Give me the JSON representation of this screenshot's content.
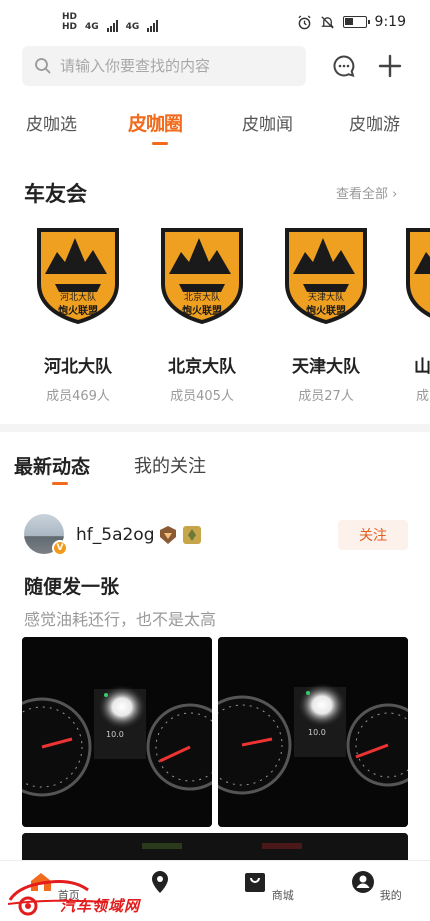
{
  "status": {
    "network1": "4G",
    "network2": "4G",
    "time": "9:19"
  },
  "search": {
    "placeholder": "请输入你要查找的内容"
  },
  "tabs": [
    "皮咖选",
    "皮咖圈",
    "皮咖闻",
    "皮咖游"
  ],
  "active_tab_index": 1,
  "clubs_section": {
    "title": "车友会",
    "see_all": "查看全部 ›",
    "badge_footer": "炮火联盟",
    "clubs": [
      {
        "badge_label": "河北大队",
        "name": "河北大队",
        "members": "成员469人"
      },
      {
        "badge_label": "北京大队",
        "name": "北京大队",
        "members": "成员405人"
      },
      {
        "badge_label": "天津大队",
        "name": "天津大队",
        "members": "成员27人"
      },
      {
        "badge_label": "山",
        "name": "山",
        "members": "成"
      }
    ]
  },
  "feed": {
    "tabs": [
      "最新动态",
      "我的关注"
    ],
    "post": {
      "username": "hf_5a2og",
      "follow_label": "关注",
      "title": "随便发一张",
      "description": "感觉油耗还行，也不是太高",
      "dash_reading": "10.0"
    }
  },
  "bottom_nav": [
    {
      "label": "首页",
      "icon": "home-icon"
    },
    {
      "label": "",
      "icon": "location-pin-icon"
    },
    {
      "label": "商城",
      "icon": "shop-bag-icon"
    },
    {
      "label": "我的",
      "icon": "profile-icon"
    }
  ],
  "watermark": {
    "text": "汽车领域网"
  },
  "colors": {
    "accent": "#f26a1b",
    "badge_orange": "#f0a020",
    "badge_dark": "#1a1a1a"
  }
}
